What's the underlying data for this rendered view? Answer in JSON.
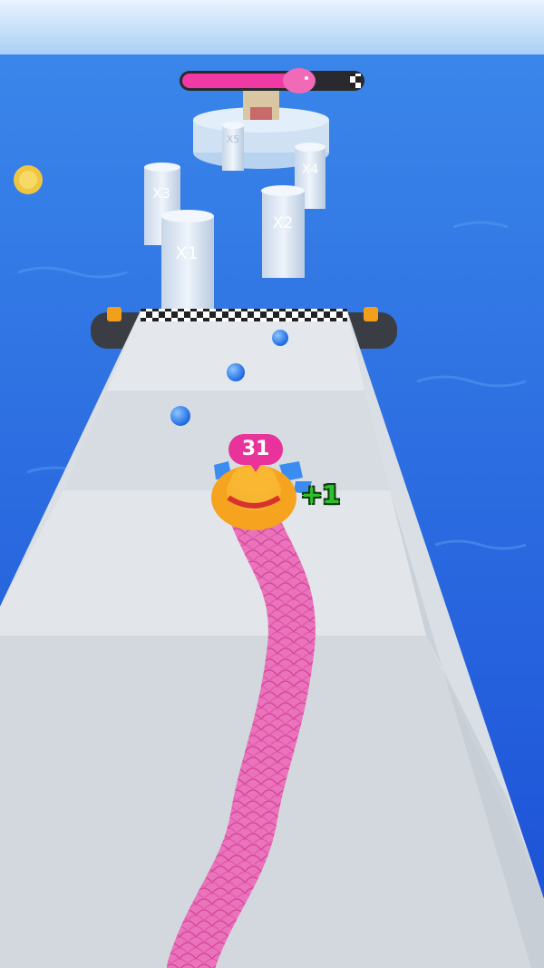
{
  "hud": {
    "length_counter": "31",
    "gain_popup": "+1",
    "level_progress": 0.7
  },
  "multiplier_pillars": [
    {
      "label": "X1"
    },
    {
      "label": "X2"
    },
    {
      "label": "X3"
    },
    {
      "label": "X4"
    },
    {
      "label": "X5"
    }
  ],
  "colors": {
    "sky": "#cfe6fb",
    "sea": "#1f5fe0",
    "track": "#dde1e6",
    "snake": "#f06ab8",
    "hat": "#f7a21b",
    "progress_fill": "#ef3aa6",
    "orb": "#1e78f0"
  },
  "icons": {
    "snake_head": "straw-hat-icon",
    "finish": "checkered-finish-line",
    "trophy": "gold-coin-icon"
  }
}
